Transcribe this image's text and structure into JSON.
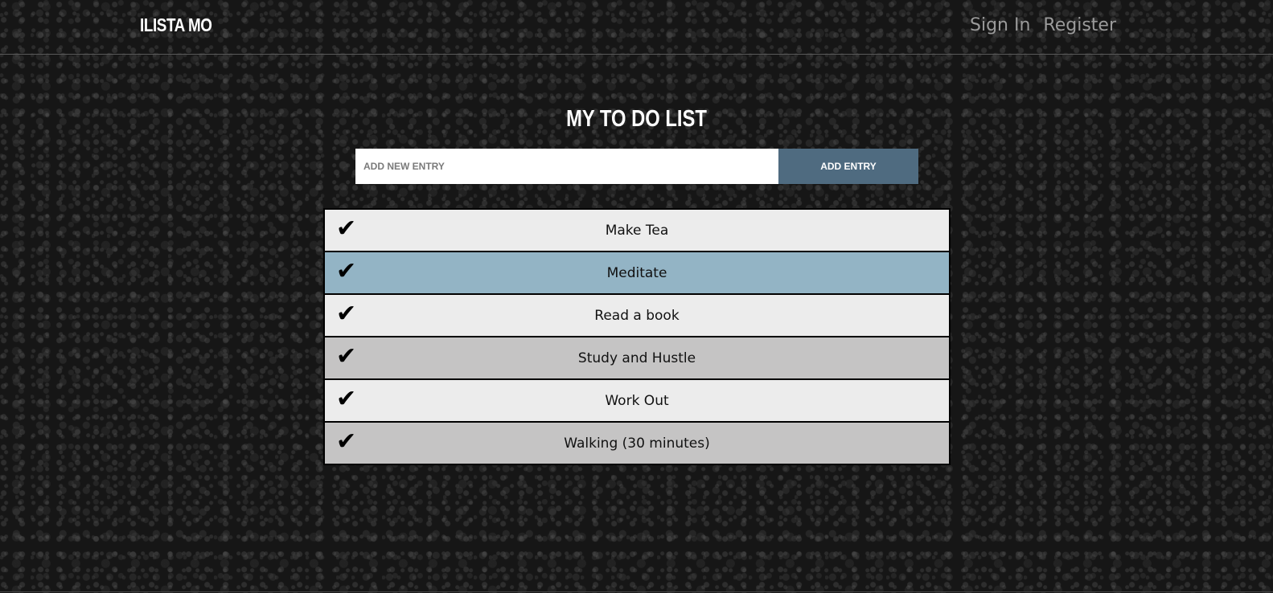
{
  "header": {
    "brand": "ILISTA MO",
    "nav": [
      {
        "label": "Sign In"
      },
      {
        "label": "Register"
      }
    ]
  },
  "main": {
    "title": "MY TO DO LIST",
    "entry": {
      "placeholder": "ADD NEW ENTRY",
      "value": "",
      "button_label": "ADD ENTRY"
    },
    "check_icon": "checkmark-icon",
    "todos": [
      {
        "text": "Make Tea",
        "color": "#ececec"
      },
      {
        "text": "Meditate",
        "color": "#93b4c5"
      },
      {
        "text": "Read a book",
        "color": "#ececec"
      },
      {
        "text": "Study and Hustle",
        "color": "#c5c4c4"
      },
      {
        "text": "Work Out",
        "color": "#ececec"
      },
      {
        "text": "Walking (30 minutes)",
        "color": "#c5c4c4"
      }
    ]
  },
  "colors": {
    "accent": "#4f6b80",
    "highlight": "#93b4c5"
  }
}
